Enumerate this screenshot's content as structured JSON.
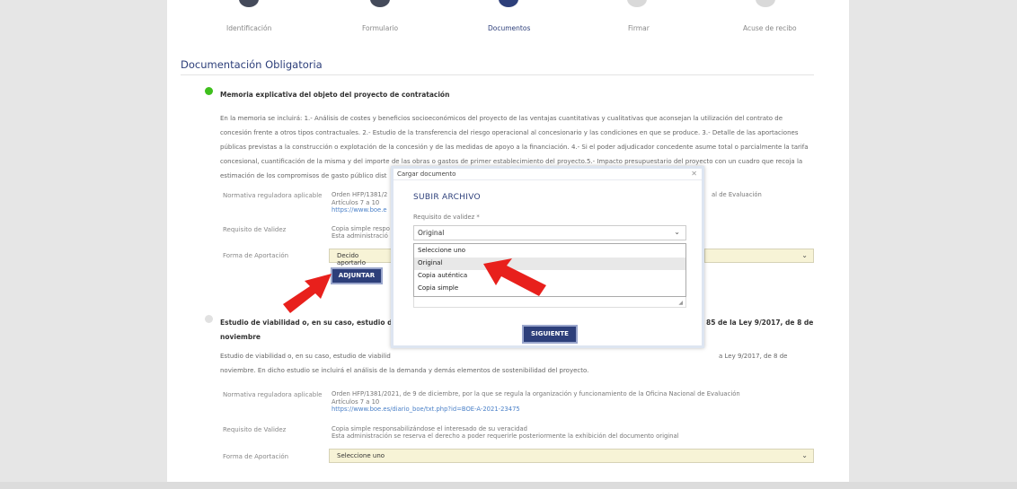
{
  "stepper": {
    "steps": [
      {
        "label": "Identificación"
      },
      {
        "label": "Formulario"
      },
      {
        "label": "Documentos"
      },
      {
        "label": "Firmar"
      },
      {
        "label": "Acuse de recibo"
      }
    ]
  },
  "section_title": "Documentación Obligatoria",
  "doc1": {
    "title": "Memoria explicativa del objeto del proyecto de contratación",
    "description": "En la memoria se incluirá: 1.- Análisis de costes y beneficios socioeconómicos del proyecto de las ventajas cuantitativas y cualitativas que aconsejan la utilización del contrato de concesión frente a otros tipos contractuales. 2.- Estudio de la transferencia del riesgo operacional al concesionario y las condiciones en que se produce. 3.- Detalle de las aportaciones públicas previstas a la construcción o explotación de la concesión y de las medidas de apoyo a la financiación. 4.- Si el poder adjudicador concedente asume total o parcialmente la tarifa concesional, cuantificación de la misma y del importe de las obras o gastos de primer establecimiento del proyecto.5.- Impacto presupuestario del proyecto con un cuadro que recoja la estimación de los compromisos de gasto público dist",
    "normativa_label": "Normativa reguladora aplicable",
    "normativa_value": "Orden HFP/1381/2",
    "normativa_tail": "al de Evaluación",
    "articulos": "Artículos 7 a 10",
    "link": "https://www.boe.e",
    "requisito_label": "Requisito de Validez",
    "requisito_line1": "Copia simple respo",
    "requisito_line2": "Esta administració",
    "forma_label": "Forma de Aportación",
    "forma_value": "Decido aportarlo",
    "adjuntar_label": "ADJUNTAR"
  },
  "doc2": {
    "title_left": "Estudio de viabilidad o, en su caso, estudio de viabi",
    "title_right": "85 de la Ley 9/2017, de 8 de",
    "title_line2": "noviembre",
    "description_line1": "Estudio de viabilidad o, en su caso, estudio de viabilid",
    "description_line1_tail": "a Ley 9/2017, de 8 de",
    "description_line2": "noviembre. En dicho estudio se incluirá el análisis de la demanda y demás elementos de sostenibilidad del proyecto.",
    "normativa_label": "Normativa reguladora aplicable",
    "normativa_value": "Orden HFP/1381/2021, de 9 de diciembre, por la que se regula la organización y funcionamiento de la Oficina Nacional de Evaluación",
    "articulos": "Artículos 7 a 10",
    "link": "https://www.boe.es/diario_boe/txt.php?id=BOE-A-2021-23475",
    "requisito_label": "Requisito de Validez",
    "requisito_line1": "Copia simple responsabilizándose el interesado de su veracidad",
    "requisito_line2": "Esta administración se reserva el derecho a poder requerirle posteriormente la exhibición del documento original",
    "forma_label": "Forma de Aportación",
    "forma_value": "Seleccione uno"
  },
  "modal": {
    "header": "Cargar documento",
    "close": "✕",
    "title": "SUBIR ARCHIVO",
    "field_label": "Requisito de validez *",
    "selected": "Original",
    "options": [
      "Seleccione uno",
      "Original",
      "Copia auténtica",
      "Copia simple"
    ],
    "highlighted_option": "Original",
    "next_label": "SIGUIENTE"
  },
  "colors": {
    "navy": "#2d3f7a",
    "green_status": "#3fbf1d",
    "select_bg": "#f7f3d6",
    "arrow_red": "#e8201c"
  }
}
